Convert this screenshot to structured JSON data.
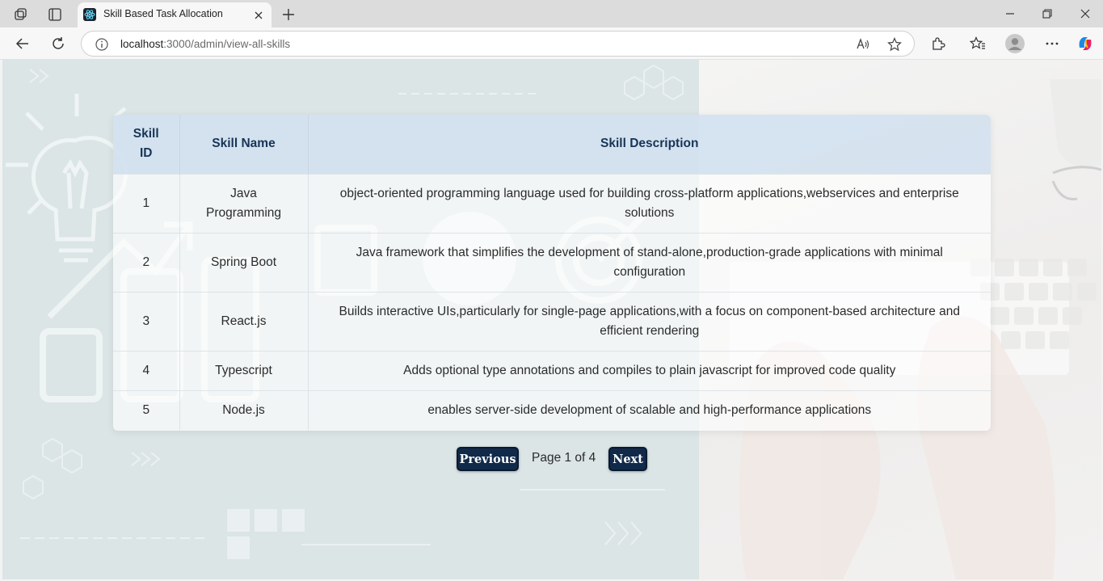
{
  "browser": {
    "tab_title": "Skill Based Task Allocation",
    "url_host": "localhost",
    "url_path": ":3000/admin/view-all-skills"
  },
  "table": {
    "headers": [
      "Skill ID",
      "Skill Name",
      "Skill Description"
    ],
    "rows": [
      {
        "id": "1",
        "name": "Java Programming",
        "description": "object-oriented programming language used for building cross-platform applications,webservices and enterprise solutions"
      },
      {
        "id": "2",
        "name": "Spring Boot",
        "description": "Java framework that simplifies the development of stand-alone,production-grade applications with minimal configuration"
      },
      {
        "id": "3",
        "name": "React.js",
        "description": "Builds interactive UIs,particularly for single-page applications,with a focus on component-based architecture and efficient rendering"
      },
      {
        "id": "4",
        "name": "Typescript",
        "description": "Adds optional type annotations and compiles to plain javascript for improved code quality"
      },
      {
        "id": "5",
        "name": "Node.js",
        "description": "enables server-side development of scalable and high-performance applications"
      }
    ]
  },
  "pagination": {
    "prev_label": "Previous",
    "page_label": "Page 1 of 4",
    "next_label": "Next"
  },
  "colors": {
    "header_bg": "#cfdeed",
    "header_text": "#173556",
    "button_bg": "#112a4a"
  }
}
